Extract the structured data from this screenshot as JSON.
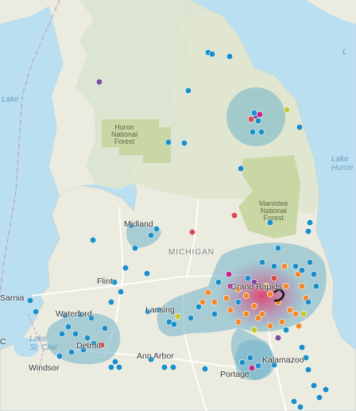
{
  "labels": {
    "huron_1": "Huron",
    "huron_2": "National",
    "huron_3": "Forest",
    "manistee_1": "Manistee",
    "manistee_2": "National",
    "manistee_3": "Forest",
    "midland": "Midland",
    "michigan": "MICHIGAN",
    "flint": "Flint",
    "lansing": "Lansing",
    "grand_rapids": "Grand Rapids",
    "ann_arbor": "Ann Arbor",
    "kalamazoo": "Kalamazoo",
    "portage": "Portage",
    "waterford": "Waterford",
    "detroit": "Detroit",
    "windsor": "Windsor",
    "sarnia": "Sarnia",
    "lake_st_clair_1": "Lake",
    "lake_st_clair_2": "St. Clair",
    "lake_west": "Lake",
    "lake_east_1": "Lake",
    "lake_east_2": "Huron",
    "lake_northeast": "L",
    "edge_c": "C"
  },
  "colors": {
    "water": "#b9dff1",
    "land": "#ecebdf",
    "forest": "#c8d7a4",
    "cluster_halo": "#6fb2c9",
    "point_blue": "#1a8fc9",
    "point_orange": "#f0892c",
    "point_red": "#d94a4a",
    "point_purple": "#7b4ba0",
    "point_magenta": "#c2258e",
    "point_yellow": "#c7c731",
    "heat_center": "#e33b6a"
  },
  "map_layers": {
    "cluster_areas": [
      "northeast",
      "grand-rapids",
      "lansing",
      "kalamazoo",
      "detroit",
      "midland"
    ],
    "heat_spot": "grand-rapids"
  }
}
